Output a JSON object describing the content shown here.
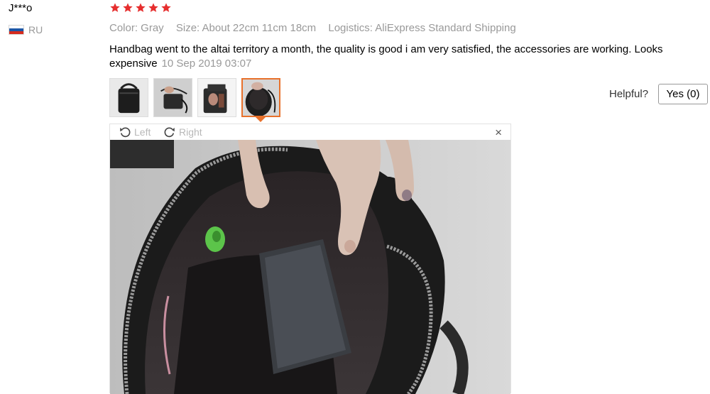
{
  "review": {
    "user": "J***o",
    "country_code": "RU",
    "rating": 5,
    "rating_max": 5,
    "star_color": "#e62e2e",
    "meta": {
      "color": "Color: Gray",
      "size": "Size: About 22cm 11cm 18cm",
      "logistics": "Logistics: AliExpress Standard Shipping"
    },
    "text": "Handbag went to the altai territory a month, the quality is good i am very satisfied, the accessories are working. Looks expensive",
    "date": "10 Sep 2019 03:07",
    "thumbnails_count": 4,
    "active_thumbnail": 4,
    "accent_color": "#e8712b"
  },
  "helpful": {
    "label": "Helpful?",
    "button": "Yes (0)"
  },
  "viewer": {
    "rotate_left": "Left",
    "rotate_right": "Right",
    "close": "×"
  }
}
